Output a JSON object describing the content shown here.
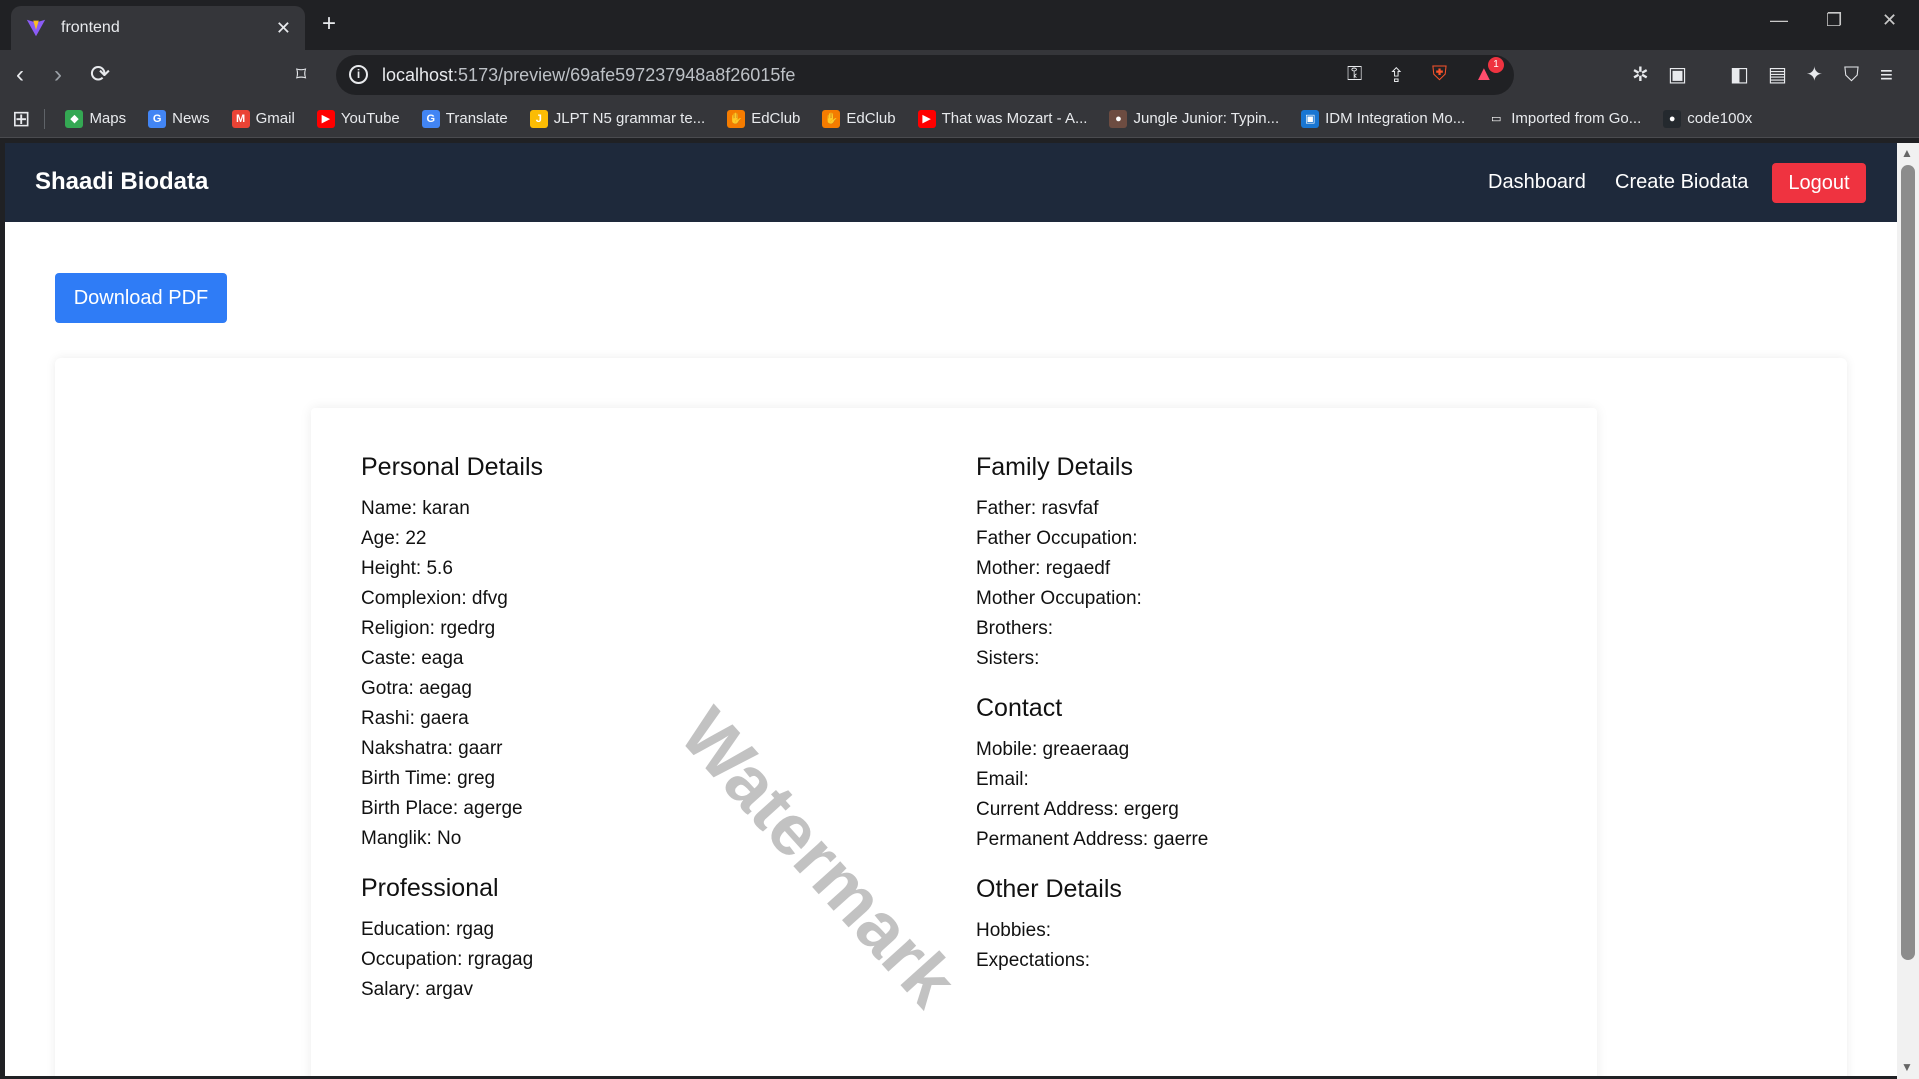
{
  "browser": {
    "tab_title": "frontend",
    "url_host": "localhost",
    "url_rest": ":5173/preview/69afe597237948a8f26015fe",
    "bookmarks": [
      {
        "label": "Maps",
        "color": "#34a853",
        "glyph": "◆"
      },
      {
        "label": "News",
        "color": "#4285f4",
        "glyph": "G"
      },
      {
        "label": "Gmail",
        "color": "#ea4335",
        "glyph": "M"
      },
      {
        "label": "YouTube",
        "color": "#ff0000",
        "glyph": "▶"
      },
      {
        "label": "Translate",
        "color": "#4285f4",
        "glyph": "G"
      },
      {
        "label": "JLPT N5 grammar te...",
        "color": "#fbbc04",
        "glyph": "J"
      },
      {
        "label": "EdClub",
        "color": "#f57c00",
        "glyph": "✋"
      },
      {
        "label": "EdClub",
        "color": "#f57c00",
        "glyph": "✋"
      },
      {
        "label": "That was Mozart - A...",
        "color": "#ff0000",
        "glyph": "▶"
      },
      {
        "label": "Jungle Junior: Typin...",
        "color": "#6d4c41",
        "glyph": "●"
      },
      {
        "label": "IDM Integration Mo...",
        "color": "#1976d2",
        "glyph": "▣"
      },
      {
        "label": "Imported from Go...",
        "color": "transparent",
        "glyph": "▭"
      },
      {
        "label": "code100x",
        "color": "#24292e",
        "glyph": "●"
      }
    ],
    "brave_badge": "1"
  },
  "navbar": {
    "brand": "Shaadi Biodata",
    "links": [
      "Dashboard",
      "Create Biodata"
    ],
    "logout": "Logout"
  },
  "download_button": "Download PDF",
  "watermark": "Watermark",
  "sections_left": [
    {
      "title": "Personal Details",
      "lines": [
        "Name: karan",
        "Age: 22",
        "Height: 5.6",
        "Complexion: dfvg",
        "Religion: rgedrg",
        "Caste: eaga",
        "Gotra: aegag",
        "Rashi: gaera",
        "Nakshatra: gaarr",
        "Birth Time: greg",
        "Birth Place: agerge",
        "Manglik: No"
      ]
    },
    {
      "title": "Professional",
      "lines": [
        "Education: rgag",
        "Occupation: rgragag",
        "Salary: argav"
      ]
    }
  ],
  "sections_right": [
    {
      "title": "Family Details",
      "lines": [
        "Father: rasvfaf",
        "Father Occupation:",
        "Mother: regaedf",
        "Mother Occupation:",
        "Brothers:",
        "Sisters:"
      ]
    },
    {
      "title": "Contact",
      "lines": [
        "Mobile: greaeraag",
        "Email:",
        "Current Address: ergerg",
        "Permanent Address: gaerre"
      ]
    },
    {
      "title": "Other Details",
      "lines": [
        "Hobbies:",
        "Expectations:"
      ]
    }
  ],
  "colors": {
    "navbar_bg": "#1e293b",
    "logout_bg": "#ef3340",
    "download_bg": "#2f7cf6"
  }
}
